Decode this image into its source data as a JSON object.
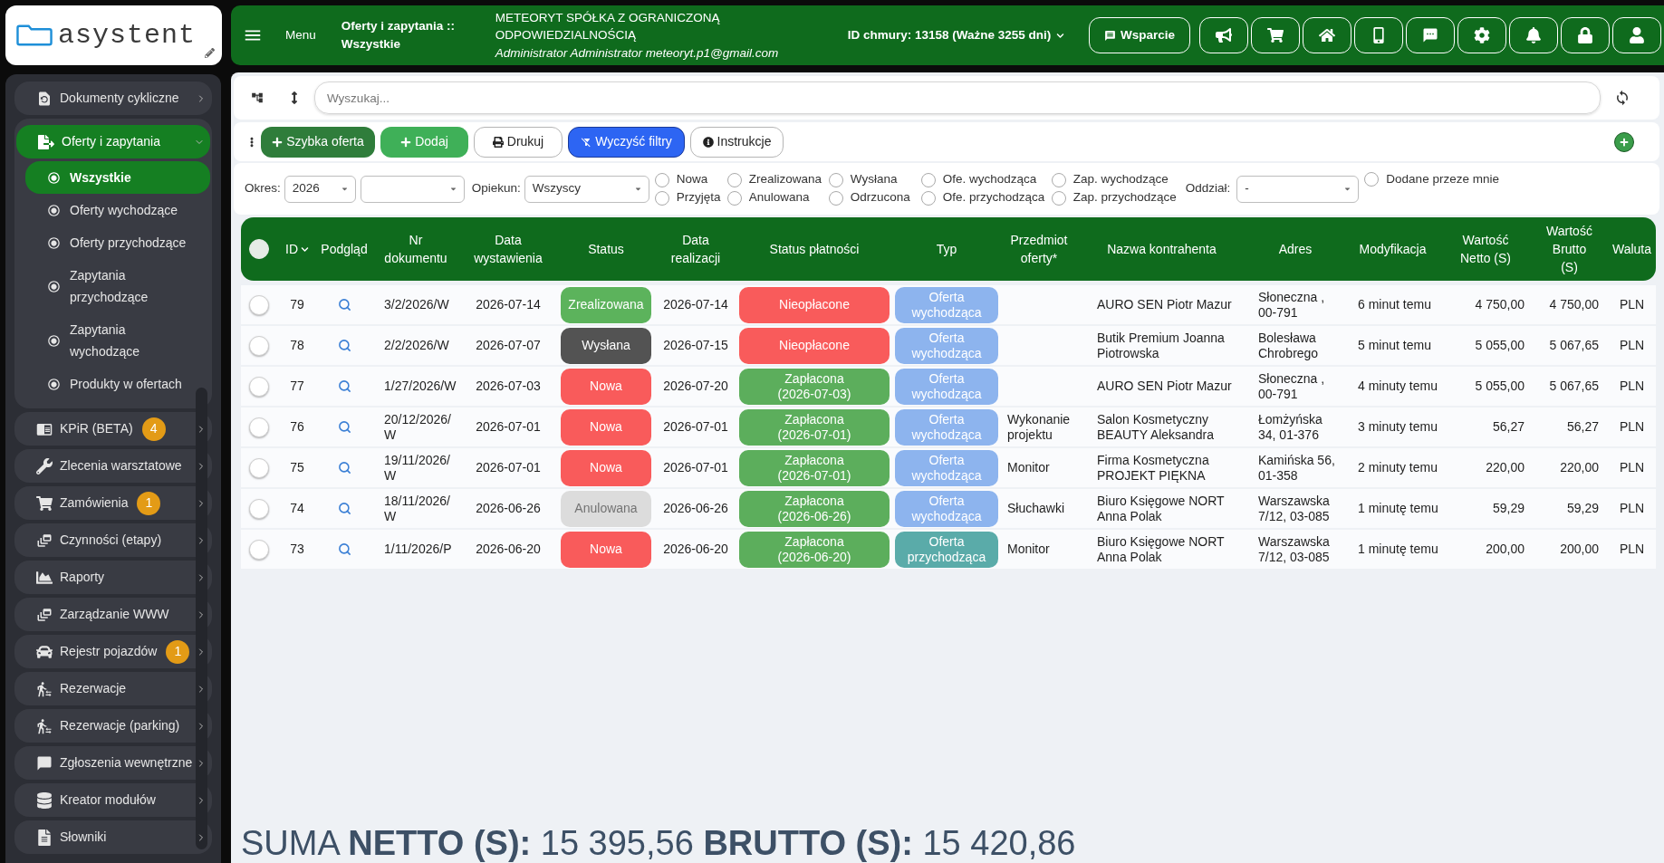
{
  "logo": {
    "text": "asystent"
  },
  "header": {
    "menu_label": "Menu",
    "page_title": "Oferty i zapytania :: Wszystkie",
    "company": "METEORYT SPÓŁKA Z OGRANICZONĄ ODPOWIEDZIALNOŚCIĄ",
    "user": "Administrator Administrator meteoryt.p1@gmail.com",
    "cloud_id": "ID chmury: 13158 (Ważne 3255 dni)",
    "support_button": "Wsparcie"
  },
  "sidebar": {
    "items": [
      {
        "label": "Dokumenty cykliczne",
        "selected": false,
        "expanded": false
      },
      {
        "label": "Oferty i zapytania",
        "selected": true,
        "expanded": true,
        "children": [
          {
            "label": "Wszystkie",
            "selected": true
          },
          {
            "label": "Oferty wychodzące",
            "selected": false
          },
          {
            "label": "Oferty przychodzące",
            "selected": false
          },
          {
            "label": "Zapytania przychodzące",
            "selected": false
          },
          {
            "label": "Zapytania wychodzące",
            "selected": false
          },
          {
            "label": "Produkty w ofertach",
            "selected": false
          }
        ]
      },
      {
        "label": "KPiR (BETA)",
        "badge": "4",
        "selected": false,
        "expanded": false
      },
      {
        "label": "Zlecenia warsztatowe",
        "selected": false,
        "expanded": false
      },
      {
        "label": "Zamówienia",
        "badge": "1",
        "selected": false,
        "expanded": false
      },
      {
        "label": "Czynności (etapy)",
        "selected": false,
        "expanded": false
      },
      {
        "label": "Raporty",
        "selected": false,
        "expanded": false
      },
      {
        "label": "Zarządzanie WWW",
        "selected": false,
        "expanded": false
      },
      {
        "label": "Rejestr pojazdów",
        "badge": "1",
        "selected": false,
        "expanded": false
      },
      {
        "label": "Rezerwacje",
        "selected": false,
        "expanded": false
      },
      {
        "label": "Rezerwacje (parking)",
        "selected": false,
        "expanded": false
      },
      {
        "label": "Zgłoszenia wewnętrzne",
        "selected": false,
        "expanded": false
      },
      {
        "label": "Kreator modułów",
        "selected": false,
        "expanded": false
      },
      {
        "label": "Słowniki",
        "selected": false,
        "expanded": false
      }
    ]
  },
  "search": {
    "placeholder": "Wyszukaj..."
  },
  "actions": [
    {
      "label": "Szybka oferta",
      "kind": "quick"
    },
    {
      "label": "Dodaj",
      "kind": "add"
    },
    {
      "label": "Drukuj",
      "kind": "print"
    },
    {
      "label": "Wyczyść filtry",
      "kind": "clear"
    },
    {
      "label": "Instrukcje",
      "kind": "help"
    }
  ],
  "filters": {
    "period_label": "Okres:",
    "period": "2026",
    "owner_label": "Opiekun:",
    "owner": "Wszyscy",
    "statuses": [
      {
        "label": "Nowa",
        "checked": false
      },
      {
        "label": "Zrealizowana",
        "checked": false
      },
      {
        "label": "Wysłana",
        "checked": false
      },
      {
        "label": "Ofe. wychodząca",
        "checked": false
      },
      {
        "label": "Zap. wychodzące",
        "checked": false
      },
      {
        "label": "Przyjęta",
        "checked": false
      },
      {
        "label": "Anulowana",
        "checked": false
      },
      {
        "label": "Odrzucona",
        "checked": false
      },
      {
        "label": "Ofe. przychodząca",
        "checked": false
      },
      {
        "label": "Zap. przychodzące",
        "checked": false
      }
    ],
    "branch_label": "Oddział:",
    "branch": "-",
    "mine": {
      "label": "Dodane przeze mnie",
      "checked": false
    }
  },
  "table": {
    "select_all": {
      "checked": false
    },
    "columns": [
      {
        "label": "ID",
        "sorted": true
      },
      {
        "label": "Podgląd",
        "sorted": false
      },
      {
        "label": "Nr dokumentu",
        "sorted": false
      },
      {
        "label": "Data wystawienia",
        "sorted": false
      },
      {
        "label": "Status",
        "sorted": false
      },
      {
        "label": "Data realizacji",
        "sorted": false
      },
      {
        "label": "Status płatności",
        "sorted": false
      },
      {
        "label": "Typ",
        "sorted": false
      },
      {
        "label": "Przedmiot oferty*",
        "sorted": false
      },
      {
        "label": "Nazwa kontrahenta",
        "sorted": false
      },
      {
        "label": "Adres",
        "sorted": false
      },
      {
        "label": "Modyfikacja",
        "sorted": false
      },
      {
        "label": "Wartość Netto (S)",
        "sorted": false
      },
      {
        "label": "Wartość Brutto (S)",
        "sorted": false
      },
      {
        "label": "Waluta",
        "sorted": false
      }
    ],
    "rows": [
      {
        "selected": false,
        "id": "79",
        "number": "3/2/2026/W",
        "issued": "2026-07-14",
        "status": {
          "label": "Zrealizowana",
          "color": "#5cb35c"
        },
        "realized": "2026-07-14",
        "payment": {
          "label": "Nieopłacone",
          "color": "#f95b5b"
        },
        "type": {
          "label": "Oferta wychodząca",
          "color": "#8db4ee"
        },
        "client": "AURO SEN Piotr Mazur",
        "address": "Słoneczna , 00-791",
        "modified": "6 minut temu",
        "net": "4 750,00",
        "gross": "4 750,00",
        "currency": "PLN"
      },
      {
        "selected": false,
        "id": "78",
        "number": "2/2/2026/W",
        "issued": "2026-07-07",
        "status": {
          "label": "Wysłana",
          "color": "#535353"
        },
        "realized": "2026-07-15",
        "payment": {
          "label": "Nieopłacone",
          "color": "#f95b5b"
        },
        "type": {
          "label": "Oferta wychodząca",
          "color": "#8db4ee"
        },
        "client": "Butik Premium Joanna Piotrowska",
        "address": "Bolesława Chrobrego",
        "modified": "5 minut temu",
        "net": "5 055,00",
        "gross": "5 067,65",
        "currency": "PLN"
      },
      {
        "selected": false,
        "id": "77",
        "number": "1/27/2026/W",
        "issued": "2026-07-03",
        "status": {
          "label": "Nowa",
          "color": "#f95b5b"
        },
        "realized": "2026-07-20",
        "payment": {
          "label": "Zapłacona (2026-07-03)",
          "color": "#5cae5c"
        },
        "type": {
          "label": "Oferta wychodząca",
          "color": "#8db4ee"
        },
        "client": "AURO SEN Piotr Mazur",
        "address": "Słoneczna , 00-791",
        "modified": "4 minuty temu",
        "net": "5 055,00",
        "gross": "5 067,65",
        "currency": "PLN"
      },
      {
        "selected": false,
        "id": "76",
        "number": "20/12/2026/W",
        "issued": "2026-07-01",
        "status": {
          "label": "Nowa",
          "color": "#f95b5b"
        },
        "realized": "2026-07-01",
        "payment": {
          "label": "Zapłacona (2026-07-01)",
          "color": "#5cae5c"
        },
        "type": {
          "label": "Oferta wychodząca",
          "color": "#8db4ee"
        },
        "subject": "Wykonanie projektu",
        "client": "Salon Kosmetyczny BEAUTY Aleksandra",
        "address": "Łomżyńska 34, 01-376",
        "modified": "3 minuty temu",
        "net": "56,27",
        "gross": "56,27",
        "currency": "PLN"
      },
      {
        "selected": false,
        "id": "75",
        "number": "19/11/2026/W",
        "issued": "2026-07-01",
        "status": {
          "label": "Nowa",
          "color": "#f95b5b"
        },
        "realized": "2026-07-01",
        "payment": {
          "label": "Zapłacona (2026-07-01)",
          "color": "#5cae5c"
        },
        "type": {
          "label": "Oferta wychodząca",
          "color": "#8db4ee"
        },
        "subject": "Monitor",
        "client": "Firma Kosmetyczna PROJEKT PIĘKNA",
        "address": "Kamińska 56, 01-358",
        "modified": "2 minuty temu",
        "net": "220,00",
        "gross": "220,00",
        "currency": "PLN"
      },
      {
        "selected": false,
        "id": "74",
        "number": "18/11/2026/W",
        "issued": "2026-06-26",
        "status": {
          "label": "Anulowana",
          "color": "#dcdcdc"
        },
        "realized": "2026-06-26",
        "payment": {
          "label": "Zapłacona (2026-06-26)",
          "color": "#5cae5c"
        },
        "type": {
          "label": "Oferta wychodząca",
          "color": "#8db4ee"
        },
        "subject": "Słuchawki",
        "client": "Biuro Księgowe NORT Anna Polak",
        "address": "Warszawska 7/12, 03-085",
        "modified": "1 minutę temu",
        "net": "59,29",
        "gross": "59,29",
        "currency": "PLN"
      },
      {
        "selected": false,
        "id": "73",
        "number": "1/11/2026/P",
        "issued": "2026-06-20",
        "status": {
          "label": "Nowa",
          "color": "#f95b5b"
        },
        "realized": "2026-06-20",
        "payment": {
          "label": "Zapłacona (2026-06-20)",
          "color": "#5cae5c"
        },
        "type": {
          "label": "Oferta przychodząca",
          "color": "#5aaba9"
        },
        "subject": "Monitor",
        "client": "Biuro Księgowe NORT Anna Polak",
        "address": "Warszawska 7/12, 03-085",
        "modified": "1 minutę temu",
        "net": "200,00",
        "gross": "200,00",
        "currency": "PLN"
      }
    ]
  },
  "summary": "SUMA **NETTO (S):** 15 395,56 **BRUTTO (S):** 15 420,86"
}
